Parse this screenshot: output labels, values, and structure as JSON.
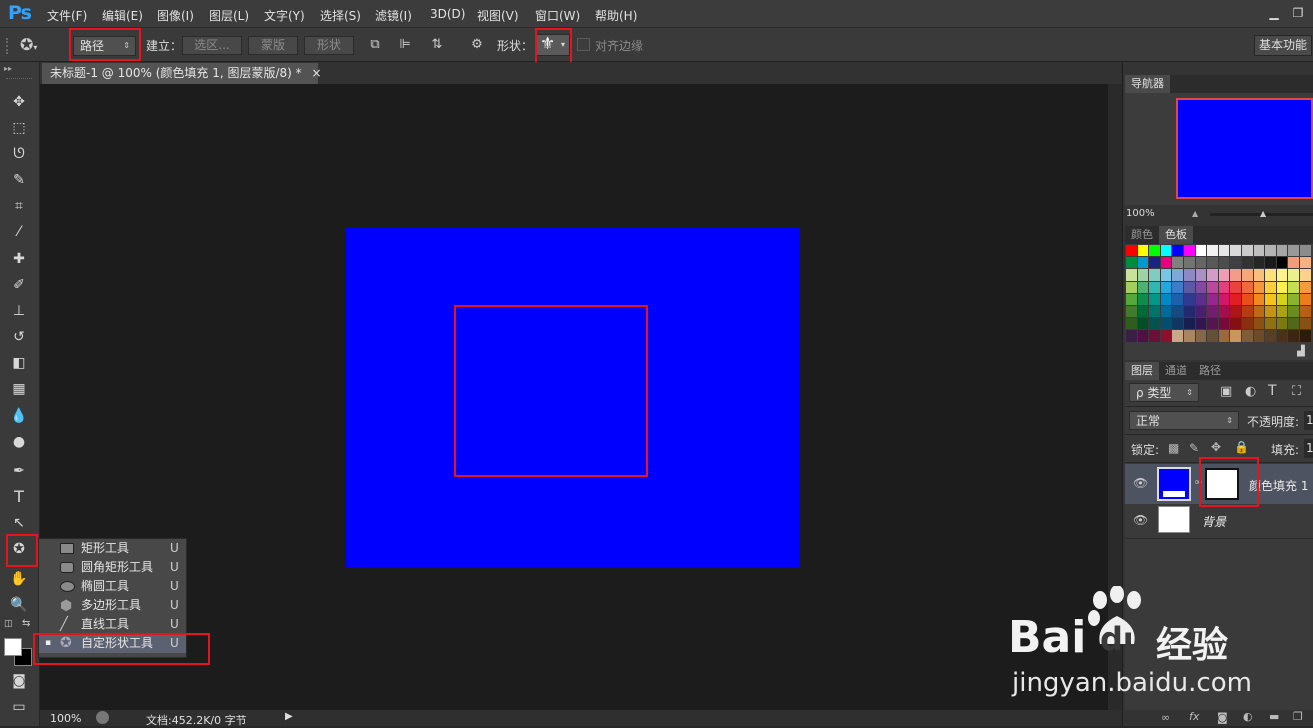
{
  "app": {
    "logo": "Ps"
  },
  "menu": [
    "文件(F)",
    "编辑(E)",
    "图像(I)",
    "图层(L)",
    "文字(Y)",
    "选择(S)",
    "滤镜(I)",
    "3D(D)",
    "视图(V)",
    "窗口(W)",
    "帮助(H)"
  ],
  "window_controls": [
    "minimize",
    "restore"
  ],
  "options": {
    "mode_value": "路径",
    "make_label": "建立：",
    "selection_btn": "选区...",
    "mask_btn": "蒙版",
    "shape_btn": "形状",
    "shape_label": "形状：",
    "align_edges": "对齐边缘",
    "workspace": "基本功能"
  },
  "document": {
    "tab_title": "未标题-1 @ 100% (颜色填充 1, 图层蒙版/8) *",
    "close": "×",
    "fill_color": "#0000ff"
  },
  "status": {
    "zoom": "100%",
    "doc_info": "文档:452.2K/0 字节"
  },
  "navigator": {
    "tab": "导航器",
    "zoom": "100%"
  },
  "color_panel": {
    "tabs": [
      "颜色",
      "色板"
    ]
  },
  "layers_panel": {
    "tabs": [
      "图层",
      "通道",
      "路径"
    ],
    "filter_type": "ρ 类型",
    "blend_mode": "正常",
    "opacity_label": "不透明度:",
    "opacity_value": "1",
    "lock_label": "锁定:",
    "fill_label": "填充:",
    "fill_value": "1",
    "layers": [
      {
        "name": "颜色填充 1",
        "thumb": "#0000ff"
      },
      {
        "name": "背景",
        "thumb": "#ffffff"
      }
    ]
  },
  "tool_flyout": {
    "items": [
      {
        "label": "矩形工具",
        "key": "U",
        "icon": "rectangle-icon"
      },
      {
        "label": "圆角矩形工具",
        "key": "U",
        "icon": "rounded-rect-icon"
      },
      {
        "label": "椭圆工具",
        "key": "U",
        "icon": "ellipse-icon"
      },
      {
        "label": "多边形工具",
        "key": "U",
        "icon": "polygon-icon"
      },
      {
        "label": "直线工具",
        "key": "U",
        "icon": "line-icon"
      },
      {
        "label": "自定形状工具",
        "key": "U",
        "icon": "custom-shape-icon",
        "active": true
      }
    ]
  },
  "watermark": {
    "brand_left": "Bai",
    "brand_right": "du",
    "brand_cn": "经验",
    "url": "jingyan.baidu.com"
  },
  "colors": {
    "accent_red": "#e8141c",
    "ps_blue": "#2fa3ff",
    "canvas_blue": "#0000ff"
  }
}
